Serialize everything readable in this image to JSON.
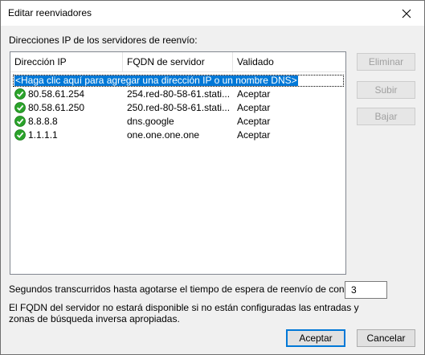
{
  "window": {
    "title": "Editar reenviadores"
  },
  "section_label": "Direcciones IP de los servidores de reenvío:",
  "columns": [
    "Dirección IP",
    "FQDN de servidor",
    "Validado"
  ],
  "add_prompt": "<Haga clic aquí para agregar una dirección IP o un nombre DNS>",
  "rows": [
    {
      "ip": "80.58.61.254",
      "fqdn": "254.red-80-58-61.stati...",
      "validated": "Aceptar",
      "icon": "check-circle-icon"
    },
    {
      "ip": "80.58.61.250",
      "fqdn": "250.red-80-58-61.stati...",
      "validated": "Aceptar",
      "icon": "check-circle-icon"
    },
    {
      "ip": "8.8.8.8",
      "fqdn": "dns.google",
      "validated": "Aceptar",
      "icon": "check-circle-icon"
    },
    {
      "ip": "1.1.1.1",
      "fqdn": "one.one.one.one",
      "validated": "Aceptar",
      "icon": "check-circle-icon"
    }
  ],
  "side_buttons": {
    "delete": "Eliminar",
    "up": "Subir",
    "down": "Bajar"
  },
  "timeout": {
    "label": "Segundos transcurridos hasta agotarse el tiempo de espera de reenvío de consultas:",
    "value": "3"
  },
  "note": "El FQDN del servidor no estará disponible si no están configuradas las entradas y zonas de búsqueda inversa apropiadas.",
  "buttons": {
    "ok": "Aceptar",
    "cancel": "Cancelar"
  },
  "colors": {
    "selection": "#0078d7",
    "check_green": "#2aa32a"
  }
}
